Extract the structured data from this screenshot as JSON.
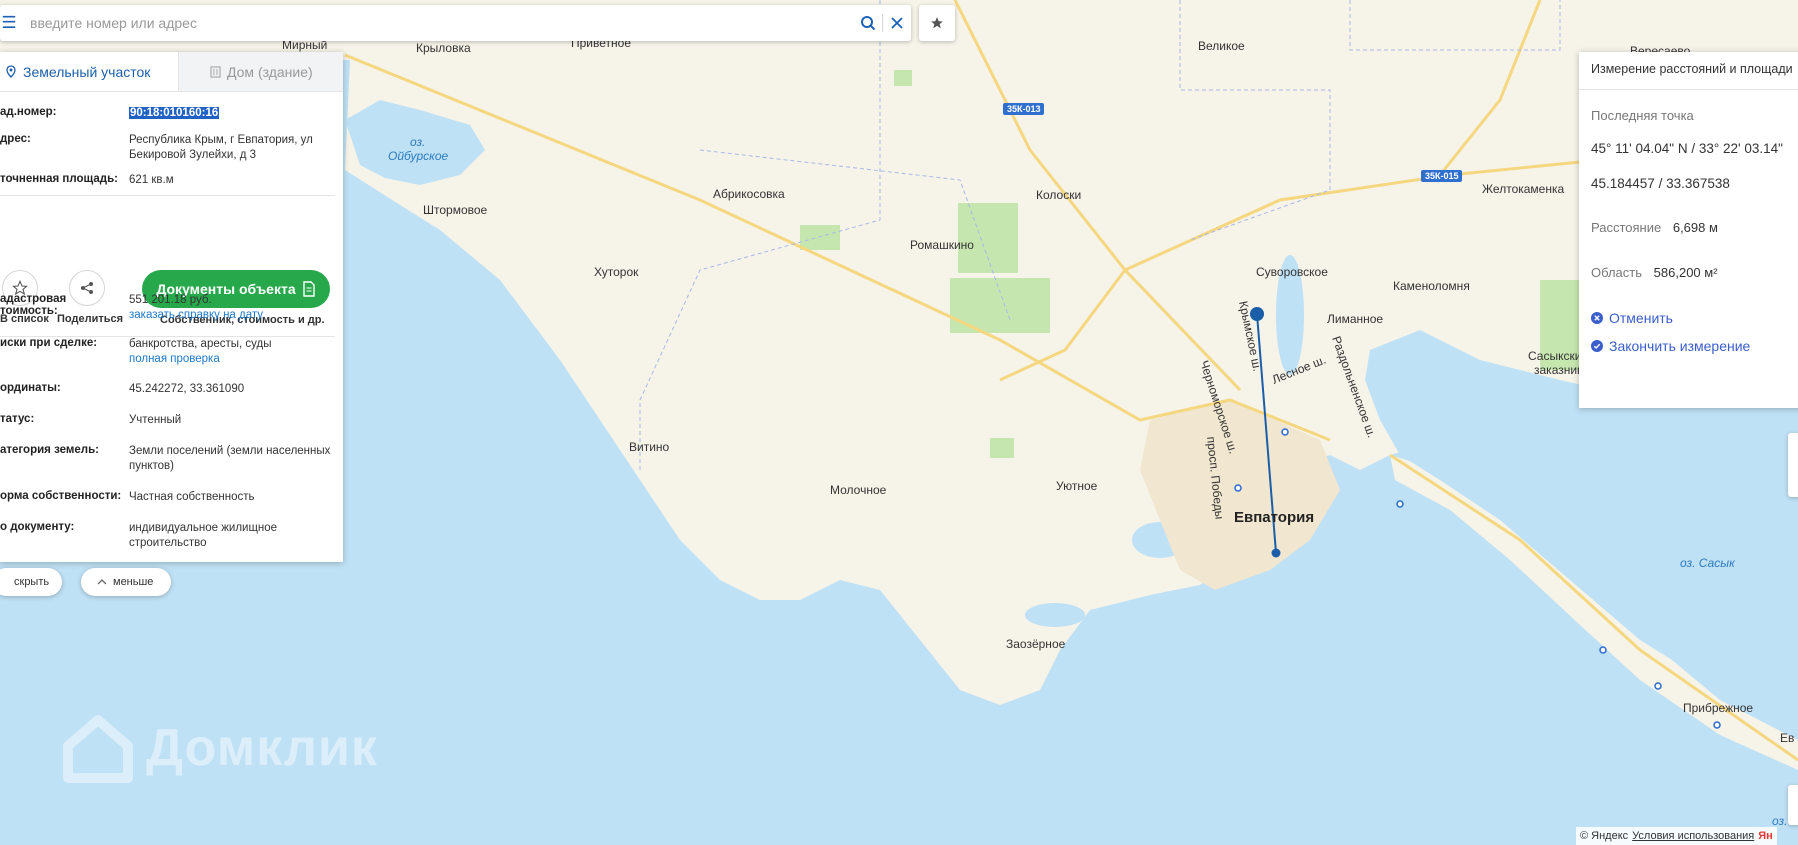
{
  "search": {
    "placeholder": "введите номер или адрес"
  },
  "panel": {
    "tabs": [
      {
        "label": "Земельный участок",
        "icon": "parcel-pin-icon",
        "active": true
      },
      {
        "label": "Дом (здание)",
        "icon": "building-icon",
        "active": false
      }
    ],
    "rows": [
      {
        "label": "ад.номер:",
        "value": "90:18:010160:16",
        "selected": true
      },
      {
        "label": "дрес:",
        "value": "Республика Крым, г Евпатория, ул Бекировой Зулейхи, д 3"
      },
      {
        "label": "точненная площадь:",
        "value": "621 кв.м"
      }
    ],
    "actions": {
      "add_label": "В список",
      "share_label": "Поделиться",
      "docs_button": "Документы объекта",
      "docs_sub": "Собственник, стоимость и др."
    },
    "details": [
      {
        "label": "адастровая\nтоимость:",
        "value": "551 201.18 руб.",
        "link": "заказать справку на дату"
      },
      {
        "label": "иски при сделке:",
        "value": "банкротства, аресты, суды",
        "link": "полная проверка"
      },
      {
        "label": "ординаты:",
        "value": "45.242272, 33.361090"
      },
      {
        "label": "татус:",
        "value": "Учтенный"
      },
      {
        "label": "атегория земель:",
        "value": "Земли поселений (земли населенных пунктов)"
      },
      {
        "label": "орма собственности:",
        "value": "Частная собственность"
      },
      {
        "label": "о документу:",
        "value": "индивидуальное жилищное строительство"
      }
    ]
  },
  "bottom_buttons": {
    "hide": "скрыть",
    "less": "меньше"
  },
  "measure": {
    "title": "Измерение расстояний и площади",
    "last_point_label": "Последняя точка",
    "dms": "45° 11' 04.04\" N / 33° 22' 03.14\"",
    "decimal": "45.184457 / 33.367538",
    "distance_label": "Расстояние",
    "distance_value": "6,698 м",
    "area_label": "Область",
    "area_value": "586,200 м²",
    "cancel": "Отменить",
    "finish": "Закончить измерение"
  },
  "map": {
    "places": {
      "mirny": "Мирный",
      "krylovka": "Крыловка",
      "privetnoe": "Приветное",
      "velikoe": "Великое",
      "veresaevo": "Вересаево",
      "ozero_label": "оз.",
      "oibur": "Ойбурское",
      "shtormovoe": "Штормовое",
      "abrikosovka": "Абрикосовка",
      "koloski": "Колоски",
      "romashkino": "Ромашкино",
      "zheltokamenka": "Желтокаменка",
      "khutorok": "Хуторок",
      "suvorovskoe": "Суворовское",
      "kamenolomnya": "Каменоломня",
      "limannoe": "Лиманное",
      "sasyk_reserve_1": "Сасыкский",
      "sasyk_reserve_2": "заказник",
      "vitino": "Витино",
      "molochnoe": "Молочное",
      "uyutnoe": "Уютное",
      "evpatoria": "Евпатория",
      "ozero_sasyk": "оз. Сасык",
      "zaozernoe": "Заозёрное",
      "pribrezhnoe": "Прибрежное",
      "ozero_short": "оз. С",
      "ev_short": "Ев",
      "chernomorskoe_sh": "Черноморское ш.",
      "krymskoe_sh": "Крымское ш.",
      "lesnoe_sh": "Лесное ш.",
      "razdolnenskoe_sh": "Раздольненское ш.",
      "prosp_pobedy": "просп. Победы"
    },
    "road_badges": {
      "r1": "35К-013",
      "r2": "35К-015"
    }
  },
  "watermark": "Домклик",
  "copyright": {
    "text": "© Яндекс",
    "terms": "Условия использования",
    "ya": "Ян"
  },
  "colors": {
    "sea": "#bfe1f5",
    "land": "#f7f4ea",
    "accent": "#1e5fab",
    "green_button": "#27a84b",
    "measure_line": "#1a5ea8"
  }
}
